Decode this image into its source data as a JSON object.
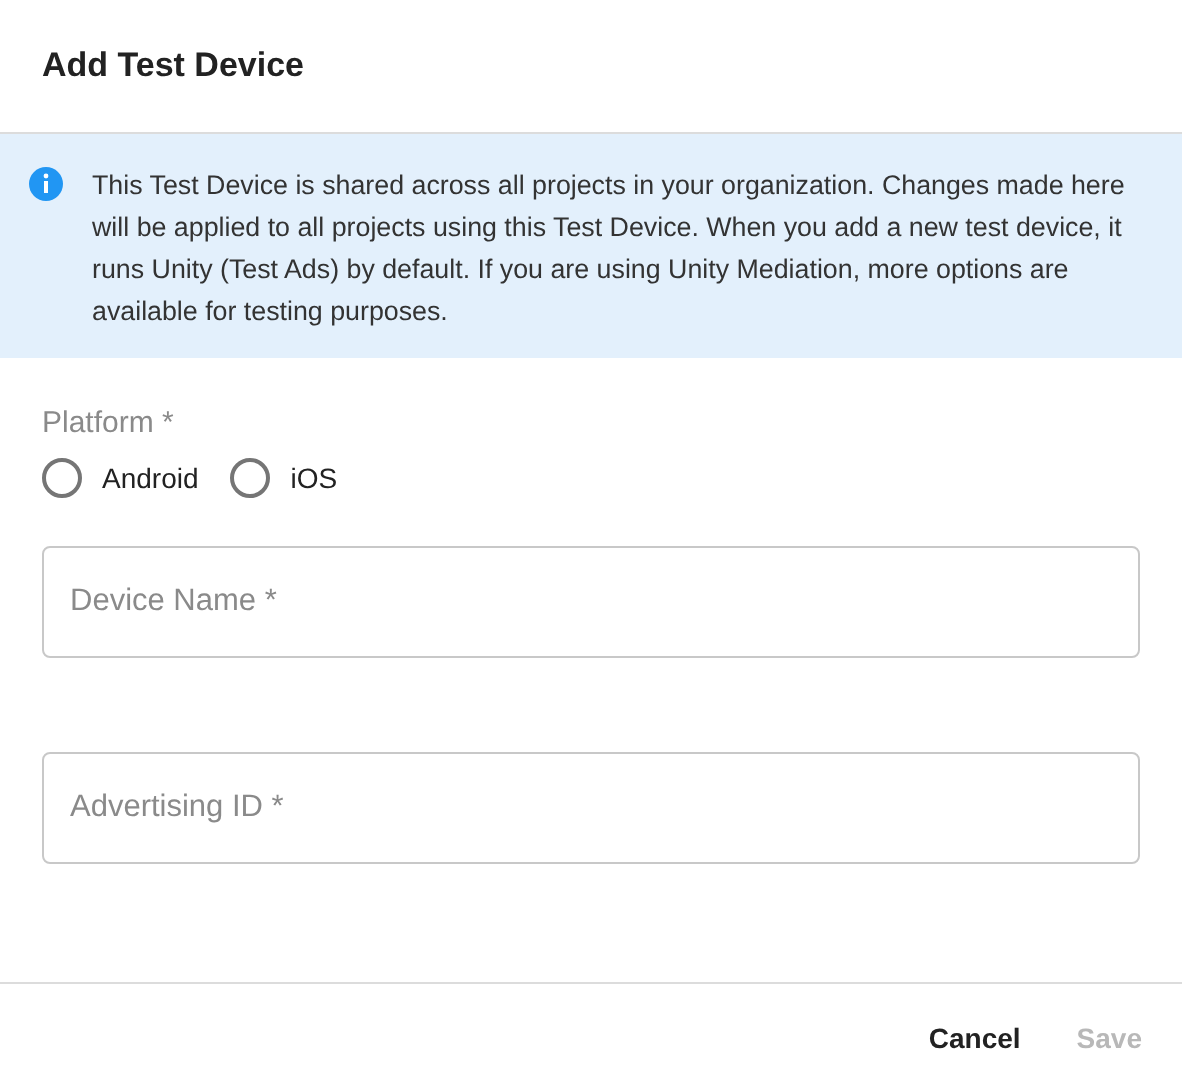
{
  "dialog": {
    "title": "Add Test Device"
  },
  "info": {
    "text": "This Test Device is shared across all projects in your organization. Changes made here will be applied to all projects using this Test Device. When you add a new test device, it runs Unity (Test Ads) by default. If you are using Unity Mediation, more options are available for testing purposes."
  },
  "platform": {
    "label": "Platform *",
    "options": [
      {
        "label": "Android",
        "selected": false
      },
      {
        "label": "iOS",
        "selected": false
      }
    ]
  },
  "fields": [
    {
      "placeholder": "Device Name *"
    },
    {
      "placeholder": "Advertising ID *"
    }
  ],
  "buttons": [
    {
      "label": "Cancel",
      "disabled": false
    },
    {
      "label": "Save",
      "disabled": true
    }
  ]
}
